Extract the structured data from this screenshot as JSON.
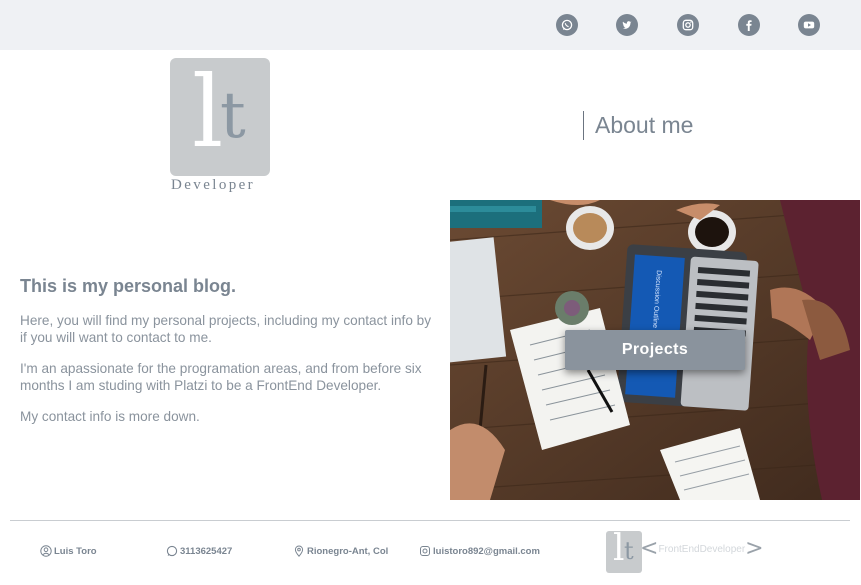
{
  "social": [
    {
      "name": "whatsapp-icon",
      "color": "#7a8591"
    },
    {
      "name": "twitter-icon",
      "color": "#7a8591"
    },
    {
      "name": "instagram-icon",
      "color": "#7a8591"
    },
    {
      "name": "facebook-icon",
      "color": "#7a8591"
    },
    {
      "name": "youtube-icon",
      "color": "#7a8591"
    }
  ],
  "logo": {
    "letter_l": "l",
    "letter_t": "t",
    "caption": "Developer"
  },
  "nav": {
    "about": "About me"
  },
  "hero": {
    "title": "This is my personal blog.",
    "p1": "Here, you will find my personal projects, including my contact info by if you will want to contact to me.",
    "p2": "I'm an apassionate for the programation areas, and from before six months I am studing with Platzi to be a FrontEnd Developer.",
    "p3": "My contact info is more down."
  },
  "photo": {
    "screen_text": "Discussion Outline"
  },
  "projects_button": "Projects",
  "footer": {
    "name": "Luis Toro",
    "phone": "3113625427",
    "location": "Rionegro-Ant, Col",
    "email": "luistoro892@gmail.com",
    "tag_open": "<",
    "tag_text": "FrontEndDeveloper",
    "tag_close": ">"
  },
  "colors": {
    "accent": "#8a939d",
    "topbar": "#eff1f4",
    "text": "#7a8591"
  }
}
